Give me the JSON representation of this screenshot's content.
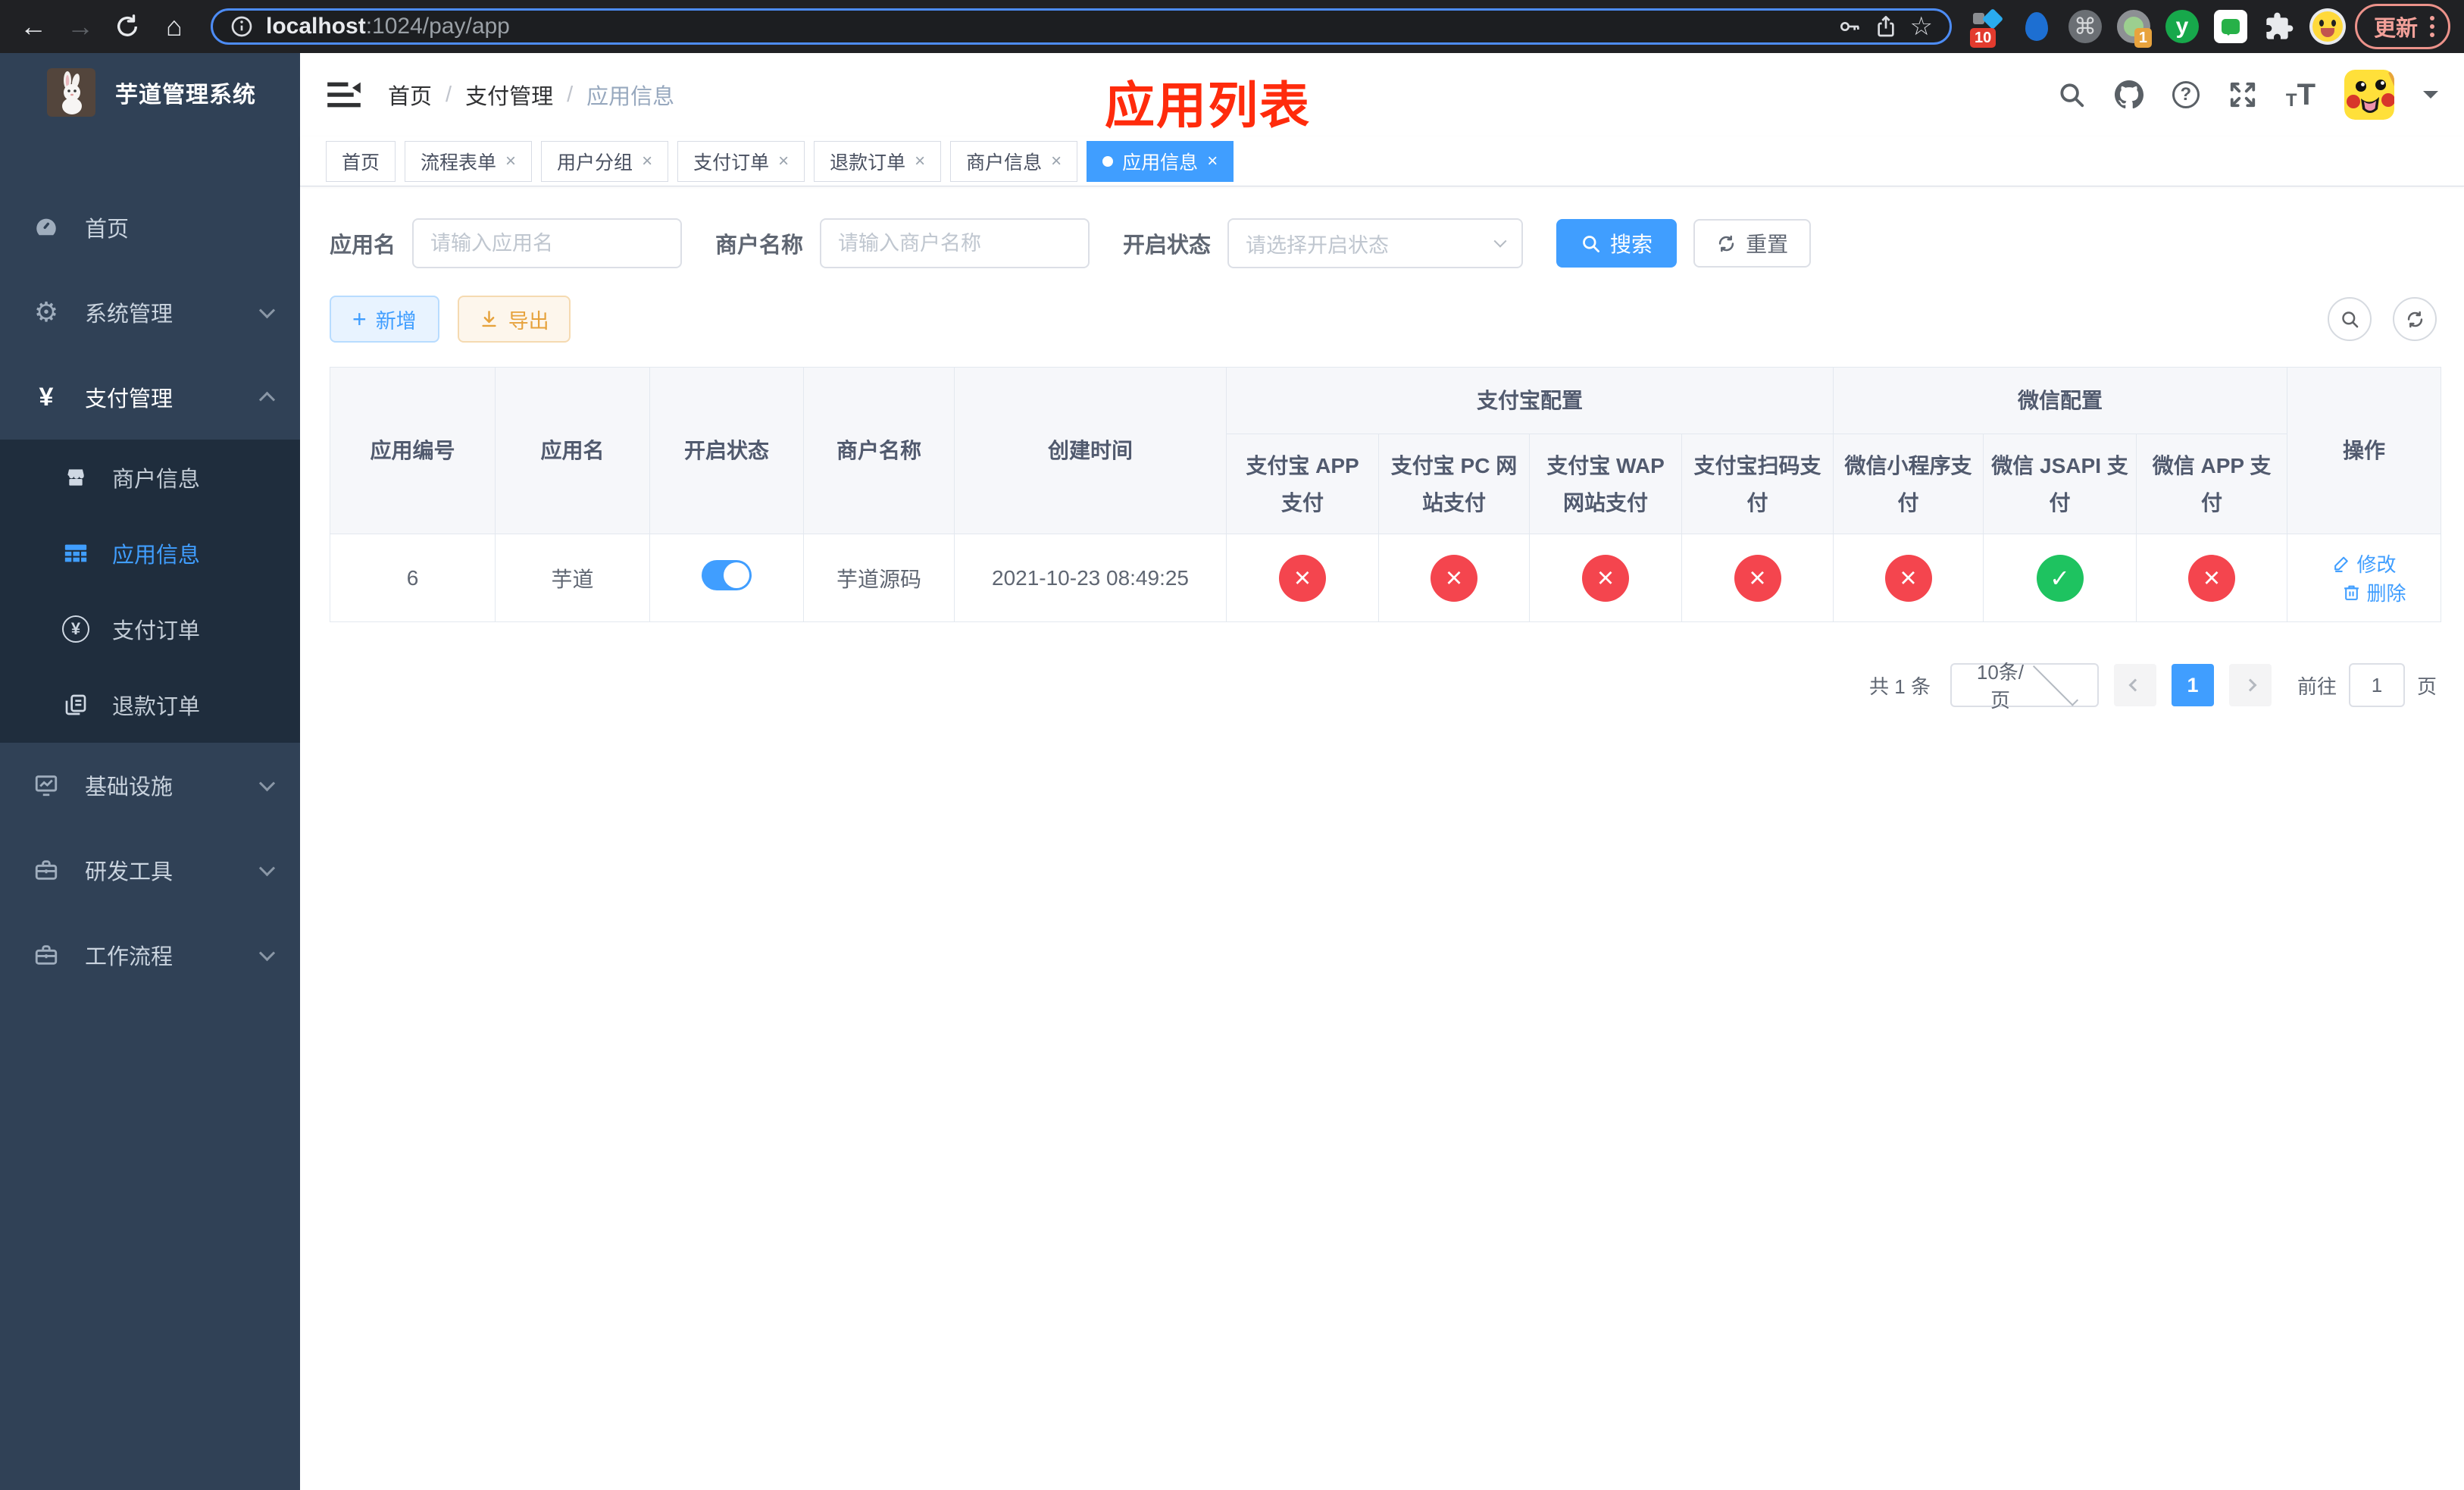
{
  "glyphs": {
    "close": "×",
    "back": "←",
    "forward": "→",
    "home": "⌂",
    "star": "☆",
    "command": "⌘",
    "gear": "⚙",
    "yen": "¥",
    "plus": "+",
    "question": "?",
    "tsize_small": "T",
    "tsize_big": "T",
    "ext_y": "y"
  },
  "browser": {
    "url_host": "localhost",
    "url_rest": ":1024/pay/app",
    "update_label": "更新",
    "ext_badge_blue": "10",
    "ext_badge_target": "1"
  },
  "sidebar": {
    "title": "芋道管理系统",
    "home": "首页",
    "system": "系统管理",
    "pay": "支付管理",
    "merchant_info": "商户信息",
    "app_info": "应用信息",
    "pay_order": "支付订单",
    "refund_order": "退款订单",
    "infra": "基础设施",
    "dev_tools": "研发工具",
    "workflow": "工作流程"
  },
  "breadcrumb": {
    "home": "首页",
    "sep": "/",
    "level1": "支付管理",
    "level2": "应用信息"
  },
  "annotation": "应用列表",
  "tabs": [
    {
      "label": "首页",
      "closable": false,
      "active": false
    },
    {
      "label": "流程表单",
      "closable": true,
      "active": false
    },
    {
      "label": "用户分组",
      "closable": true,
      "active": false
    },
    {
      "label": "支付订单",
      "closable": true,
      "active": false
    },
    {
      "label": "退款订单",
      "closable": true,
      "active": false
    },
    {
      "label": "商户信息",
      "closable": true,
      "active": false
    },
    {
      "label": "应用信息",
      "closable": true,
      "active": true
    }
  ],
  "filter": {
    "app_name_label": "应用名",
    "app_name_placeholder": "请输入应用名",
    "merchant_label": "商户名称",
    "merchant_placeholder": "请输入商户名称",
    "status_label": "开启状态",
    "status_placeholder": "请选择开启状态",
    "search_label": "搜索",
    "reset_label": "重置"
  },
  "toolbar": {
    "add_label": "新增",
    "export_label": "导出"
  },
  "table": {
    "headers": {
      "app_id": "应用编号",
      "app_name": "应用名",
      "status": "开启状态",
      "merchant": "商户名称",
      "created": "创建时间",
      "alipay_group": "支付宝配置",
      "wechat_group": "微信配置",
      "actions": "操作",
      "alipay_app": "支付宝 APP 支付",
      "alipay_pc": "支付宝 PC 网站支付",
      "alipay_wap": "支付宝 WAP 网站支付",
      "alipay_qr": "支付宝扫码支付",
      "wx_lite": "微信小程序支付",
      "wx_jsapi": "微信 JSAPI 支付",
      "wx_app": "微信 APP 支付"
    },
    "rows": [
      {
        "id": "6",
        "name": "芋道",
        "enabled": "on",
        "merchant": "芋道源码",
        "created": "2021-10-23 08:49:25",
        "channels": [
          "off",
          "off",
          "off",
          "off",
          "off",
          "on",
          "off"
        ],
        "edit_label": "修改",
        "delete_label": "删除"
      }
    ]
  },
  "pagination": {
    "total": "共 1 条",
    "page_size": "10条/页",
    "page": "1",
    "goto_label": "前往",
    "goto_value": "1",
    "page_unit": "页"
  },
  "colors": {
    "accent": "#409EFF",
    "danger": "#F4454E",
    "success": "#1EC360",
    "annotation_red": "#FF2B0C"
  }
}
